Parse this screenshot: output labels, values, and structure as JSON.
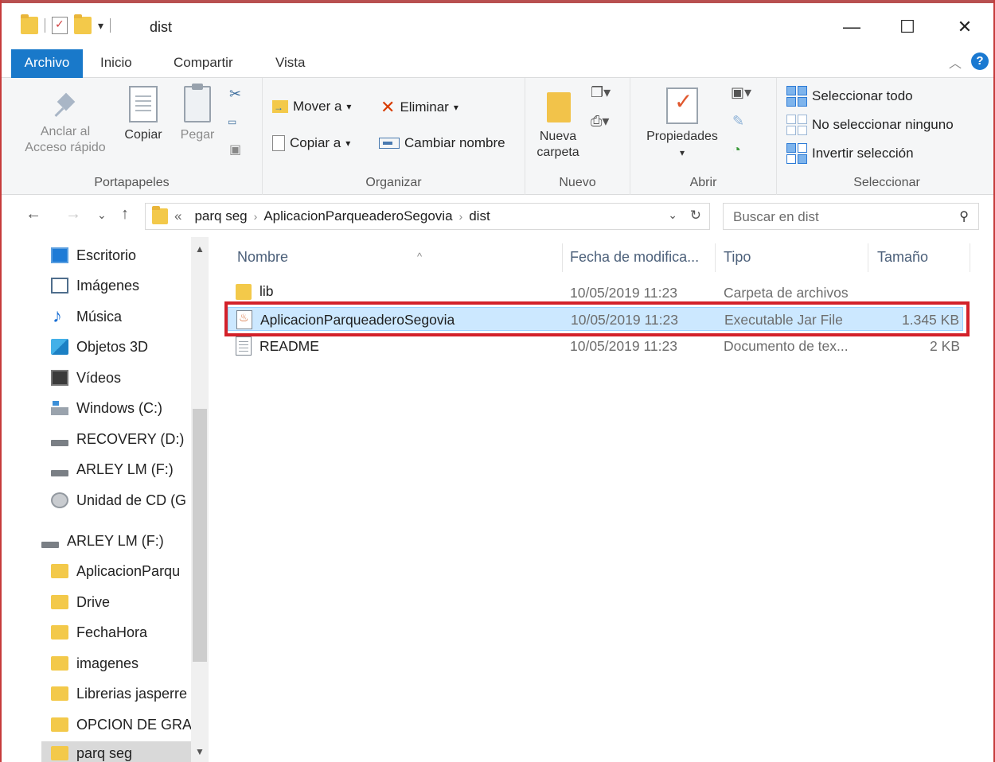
{
  "window": {
    "title": "dist",
    "minimize": "—",
    "maximize": "☐",
    "close": "✕"
  },
  "tabs": {
    "file": "Archivo",
    "home": "Inicio",
    "share": "Compartir",
    "view": "Vista",
    "help": "?"
  },
  "ribbon": {
    "clipboard": {
      "label": "Portapapeles",
      "pin_line1": "Anclar al",
      "pin_line2": "Acceso rápido",
      "copy": "Copiar",
      "paste": "Pegar"
    },
    "organize": {
      "label": "Organizar",
      "move_to": "Mover a",
      "copy_to": "Copiar a",
      "delete": "Eliminar",
      "rename": "Cambiar nombre"
    },
    "new": {
      "label": "Nuevo",
      "new_folder_line1": "Nueva",
      "new_folder_line2": "carpeta"
    },
    "open": {
      "label": "Abrir",
      "properties": "Propiedades"
    },
    "select": {
      "label": "Seleccionar",
      "select_all": "Seleccionar todo",
      "select_none": "No seleccionar ninguno",
      "invert": "Invertir selección"
    }
  },
  "address": {
    "overflow": "«",
    "segments": [
      "parq seg",
      "AplicacionParqueaderoSegovia",
      "dist"
    ],
    "search_placeholder": "Buscar en dist"
  },
  "nav": {
    "items": [
      {
        "label": "Escritorio",
        "icon": "desktop-icon"
      },
      {
        "label": "Imágenes",
        "icon": "pictures-icon"
      },
      {
        "label": "Música",
        "icon": "music-icon"
      },
      {
        "label": "Objetos 3D",
        "icon": "objects3d-icon"
      },
      {
        "label": "Vídeos",
        "icon": "videos-icon"
      },
      {
        "label": "Windows (C:)",
        "icon": "windows-drive-icon"
      },
      {
        "label": "RECOVERY (D:)",
        "icon": "drive-icon"
      },
      {
        "label": "ARLEY LM (F:)",
        "icon": "drive-icon"
      },
      {
        "label": "Unidad de CD (G",
        "icon": "cd-drive-icon"
      }
    ],
    "drive": {
      "label": "ARLEY LM (F:)",
      "icon": "drive-icon"
    },
    "folders": [
      "AplicacionParqu",
      "Drive",
      "FechaHora",
      "imagenes",
      "Librerias jasperre",
      "OPCION DE GRA",
      "parq seg"
    ]
  },
  "columns": {
    "name": "Nombre",
    "date": "Fecha de modifica...",
    "type": "Tipo",
    "size": "Tamaño"
  },
  "files": [
    {
      "name": "lib",
      "date": "10/05/2019 11:23",
      "type": "Carpeta de archivos",
      "size": "",
      "icon": "folder-icon"
    },
    {
      "name": "AplicacionParqueaderoSegovia",
      "date": "10/05/2019 11:23",
      "type": "Executable Jar File",
      "size": "1.345 KB",
      "icon": "jar-file-icon"
    },
    {
      "name": "README",
      "date": "10/05/2019 11:23",
      "type": "Documento de tex...",
      "size": "2 KB",
      "icon": "text-file-icon"
    }
  ],
  "colors": {
    "accent": "#1979ca",
    "selection": "#cce8ff",
    "highlight_box": "#d3212a",
    "folder": "#f3c94a"
  }
}
